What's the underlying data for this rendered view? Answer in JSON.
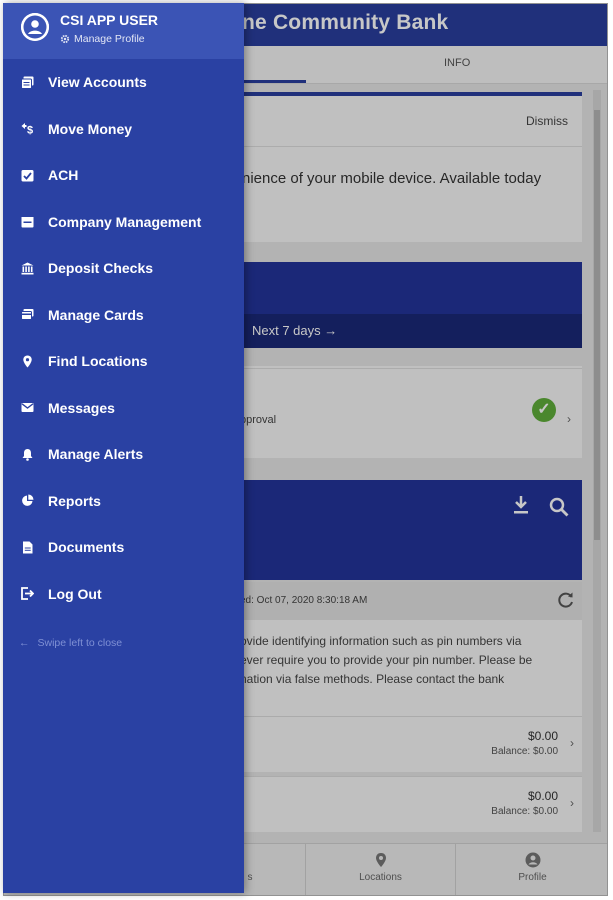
{
  "app": {
    "title": "ne Community Bank",
    "tabs": {
      "info_label": "INFO"
    }
  },
  "background": {
    "banner": {
      "dismiss_label": "Dismiss",
      "message": "nience of your mobile device. Available today"
    },
    "activity": {
      "next_days_label": "Next 7 days →"
    },
    "approval": {
      "label": "pproval"
    },
    "accounts": {
      "updated_text": "ed: Oct 07, 2020 8:30:18 AM",
      "notice_lines": [
        "ovide identifying information such as pin numbers via",
        "ever require you to provide your pin number. Please be",
        "nation via false methods. Please contact the bank"
      ],
      "rows": [
        {
          "amount": "$0.00",
          "balance": "Balance: $0.00"
        },
        {
          "amount": "$0.00",
          "balance": "Balance: $0.00"
        }
      ]
    }
  },
  "bottom_nav": {
    "items": [
      {
        "label": "s"
      },
      {
        "label": "Locations"
      },
      {
        "label": "Profile"
      }
    ]
  },
  "drawer": {
    "user_name": "CSI APP USER",
    "manage_profile_label": "Manage Profile",
    "menu": [
      {
        "label": "View Accounts",
        "icon": "accounts-icon"
      },
      {
        "label": "Move Money",
        "icon": "transfer-icon"
      },
      {
        "label": "ACH",
        "icon": "checkbox-icon"
      },
      {
        "label": "Company Management",
        "icon": "company-icon"
      },
      {
        "label": "Deposit Checks",
        "icon": "bank-icon"
      },
      {
        "label": "Manage Cards",
        "icon": "card-icon"
      },
      {
        "label": "Find Locations",
        "icon": "location-pin-icon"
      },
      {
        "label": "Messages",
        "icon": "mail-icon"
      },
      {
        "label": "Manage Alerts",
        "icon": "bell-icon"
      },
      {
        "label": "Reports",
        "icon": "pie-chart-icon"
      },
      {
        "label": "Documents",
        "icon": "document-icon"
      },
      {
        "label": "Log Out",
        "icon": "logout-icon"
      }
    ],
    "swipe_hint": "Swipe left to close"
  },
  "colors": {
    "brand_blue": "#2a41a3",
    "header_blue": "#3b54b5",
    "approved_green": "#5fae3a"
  }
}
